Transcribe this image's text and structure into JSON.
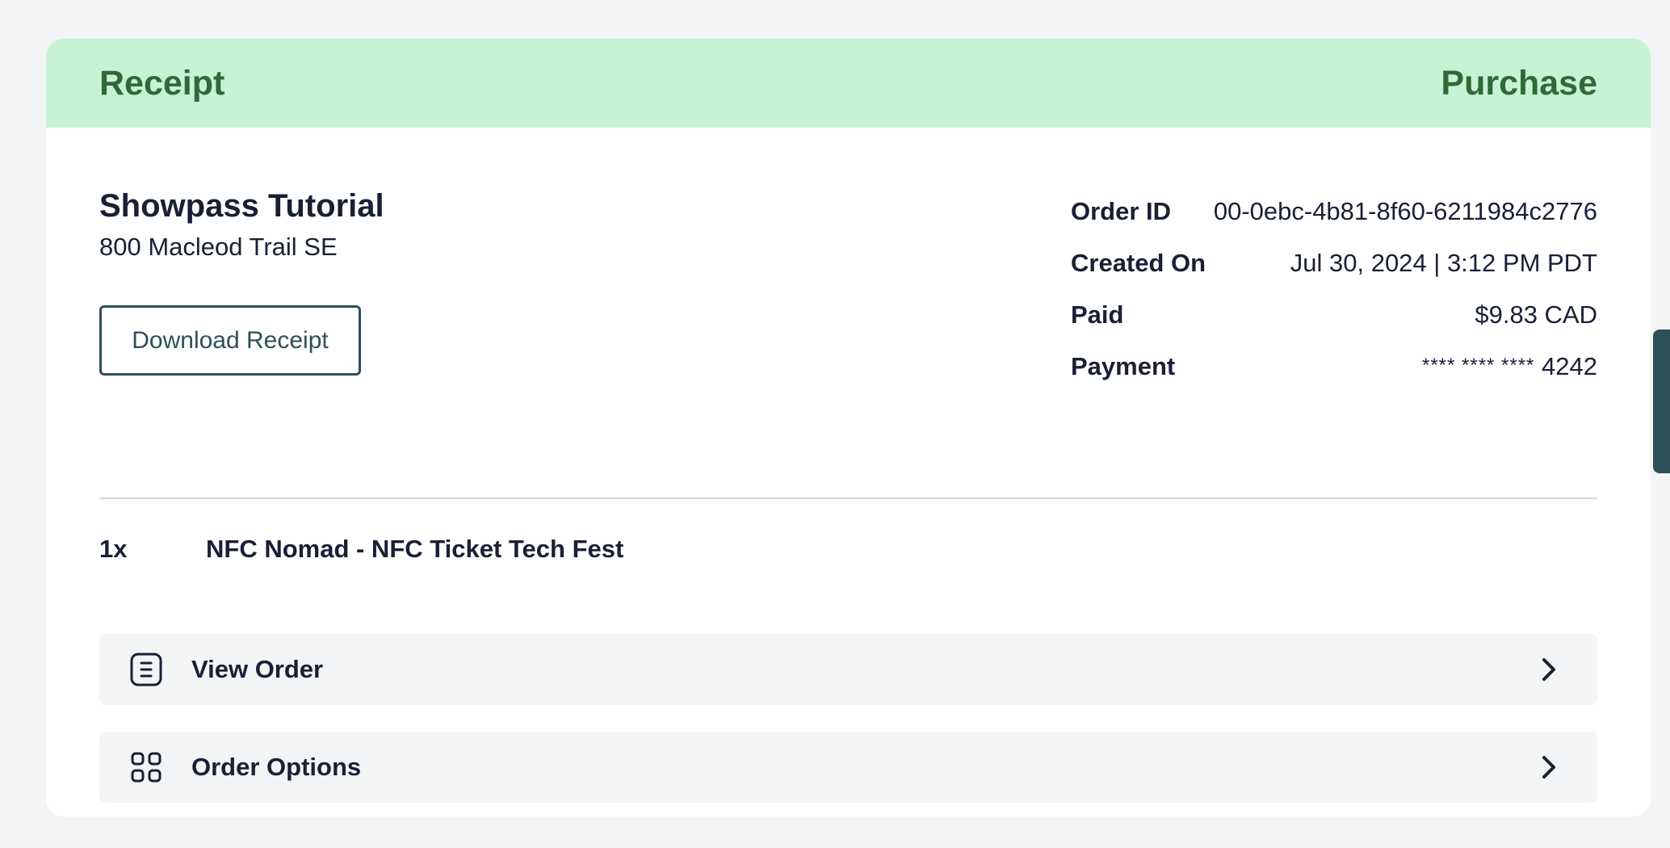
{
  "header": {
    "left_title": "Receipt",
    "right_title": "Purchase"
  },
  "venue": {
    "name": "Showpass Tutorial",
    "address": "800 Macleod Trail SE"
  },
  "download_button": "Download Receipt",
  "details": [
    {
      "label": "Order ID",
      "value": "00-0ebc-4b81-8f60-6211984c2776"
    },
    {
      "label": "Created On",
      "value": "Jul 30, 2024 | 3:12 PM PDT"
    },
    {
      "label": "Paid",
      "value": "$9.83 CAD"
    },
    {
      "label": "Payment",
      "mask": "**** **** ****",
      "last4": "4242"
    }
  ],
  "line_item": {
    "qty": "1x",
    "name": "NFC Nomad - NFC Ticket Tech Fest"
  },
  "actions": [
    {
      "label": "View Order",
      "icon": "document-list-icon"
    },
    {
      "label": "Order Options",
      "icon": "grid-icon"
    }
  ],
  "colors": {
    "header_bg": "#c6f3d3",
    "header_text": "#2e6a37",
    "button_border": "#2d5058",
    "page_bg": "#f3f4f6"
  }
}
